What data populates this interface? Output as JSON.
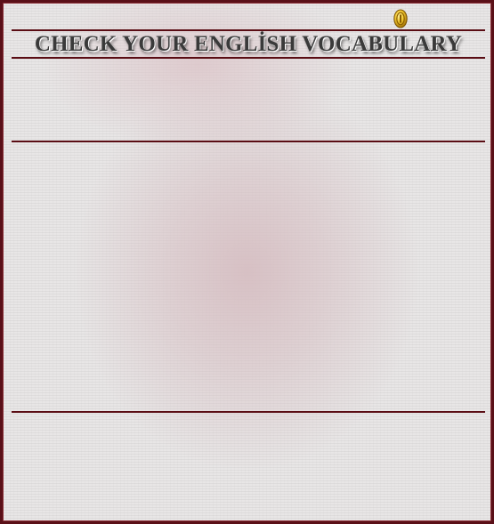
{
  "page": {
    "title": "CHECK YOUR ENGLİSH VOCABULARY",
    "colors": {
      "accent": "#5a0d14",
      "title_text": "#3a3a3a",
      "background": "#e8e6e6",
      "coin": "#e0b020"
    },
    "icons": {
      "coin": "gold-coin-icon"
    }
  }
}
